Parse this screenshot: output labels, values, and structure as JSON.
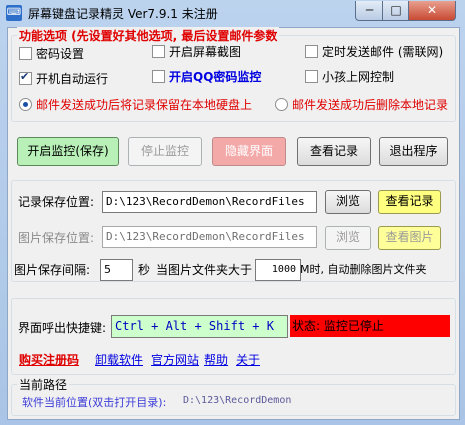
{
  "window": {
    "title": "屏幕键盘记录精灵 Ver7.9.1  未注册",
    "min_label": "─",
    "max_label": "□",
    "close_label": "✕"
  },
  "options": {
    "group_title": "功能选项 (先设置好其他选项, 最后设置邮件参数",
    "password_settings": "密码设置",
    "screen_capture": "开启屏幕截图",
    "timed_email": "定时发送邮件 (需联网)",
    "autostart": "开机自动运行",
    "qq_monitor": "开启QQ密码监控",
    "kid_control": "小孩上网控制",
    "radio_keep": "邮件发送成功后将记录保留在本地硬盘上",
    "radio_delete": "邮件发送成功后删除本地记录",
    "checked": {
      "password_settings": false,
      "screen_capture": false,
      "timed_email": false,
      "autostart": true,
      "qq_monitor": false,
      "kid_control": false
    },
    "selected_radio": "keep"
  },
  "actions": {
    "start": "开启监控(保存)",
    "stop": "停止监控",
    "hide": "隐藏界面",
    "view": "查看记录",
    "exit": "退出程序"
  },
  "storage": {
    "record_label": "记录保存位置:",
    "record_path": "D:\\123\\RecordDemon\\RecordFiles",
    "browse": "浏览",
    "view_record": "查看记录",
    "image_label": "图片保存位置:",
    "image_path": "D:\\123\\RecordDemon\\RecordFiles",
    "view_image": "查看图片",
    "interval_label": "图片保存间隔:",
    "interval_value": "5",
    "interval_unit": "秒",
    "folder_label": "当图片文件夹大于",
    "folder_size": "1000",
    "folder_suffix": "M时, 自动删除图片文件夹"
  },
  "hotkey": {
    "label": "界面呼出快捷键:",
    "value": "Ctrl + Alt + Shift + K",
    "status": "状态: 监控已停止"
  },
  "links": {
    "register": "购买注册码",
    "uninstall": "卸载软件",
    "website": "官方网站",
    "help": "帮助",
    "about": "关于"
  },
  "path": {
    "group_title": "当前路径",
    "label": "软件当前位置(双击打开目录):",
    "value": "D:\\123\\RecordDemon"
  },
  "colors": {
    "accent_red": "#e00000",
    "accent_blue": "#0000e0",
    "start_green": "#b8f0b8",
    "status_red": "#ff0000",
    "hotkey_green": "#ccffcc"
  }
}
